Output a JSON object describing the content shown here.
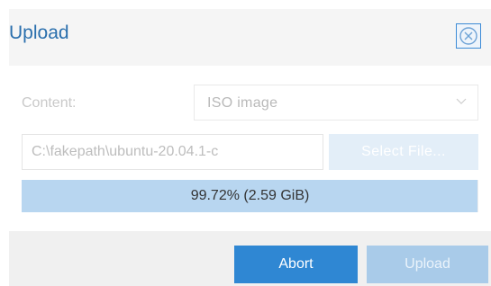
{
  "dialog": {
    "title": "Upload",
    "close_icon": "close-circle-icon"
  },
  "form": {
    "content_label": "Content:",
    "content_select": {
      "value": "ISO image",
      "arrow_icon": "chevron-down-icon"
    },
    "file_path_value": "C:\\fakepath\\ubuntu-20.04.1-c",
    "select_file_label": "Select File..."
  },
  "progress": {
    "percent": 99.72,
    "label": "99.72% (2.59 GiB)"
  },
  "footer": {
    "abort_label": "Abort",
    "upload_label": "Upload"
  },
  "colors": {
    "accent": "#2f87d3",
    "title": "#2a6fad",
    "progress_fill": "#b8d6f0",
    "disabled_button": "#a9cbe9"
  }
}
